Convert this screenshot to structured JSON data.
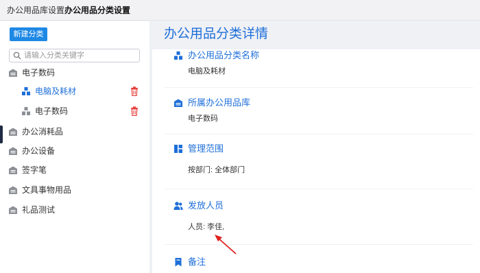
{
  "tabs": [
    {
      "label": "办公用品库设置"
    },
    {
      "label": "办公用品分类设置"
    }
  ],
  "sidebar": {
    "new_button": "新建分类",
    "search_placeholder": "请输入分类关键字",
    "items": [
      {
        "label": "电子数码",
        "icon": "warehouse-icon"
      },
      {
        "label": "电脑及耗材",
        "icon": "category-icon",
        "selected": true,
        "deletable": true
      },
      {
        "label": "电子数码",
        "icon": "category-icon",
        "deletable": true
      },
      {
        "label": "办公消耗品",
        "icon": "warehouse-icon"
      },
      {
        "label": "办公设备",
        "icon": "warehouse-icon"
      },
      {
        "label": "签字笔",
        "icon": "warehouse-icon"
      },
      {
        "label": "文具事物用品",
        "icon": "warehouse-icon"
      },
      {
        "label": "礼品测试",
        "icon": "warehouse-icon"
      }
    ]
  },
  "detail": {
    "title": "办公用品分类详情",
    "sections": [
      {
        "title": "办公用品分类名称",
        "value": "电脑及耗材",
        "icon": "category-icon"
      },
      {
        "title": "所属办公用品库",
        "value": "电子数码",
        "icon": "warehouse-icon"
      },
      {
        "title": "管理范围",
        "value": "按部门: 全体部门",
        "icon": "scope-icon"
      },
      {
        "title": "发放人员",
        "value": "人员: 李佳,",
        "icon": "users-icon"
      },
      {
        "title": "备注",
        "value": "",
        "icon": "bookmark-icon"
      }
    ]
  },
  "colors": {
    "accent": "#1e6fd9",
    "button": "#1e88e5",
    "danger": "#e53935",
    "annotation_arrow": "#e02020"
  }
}
